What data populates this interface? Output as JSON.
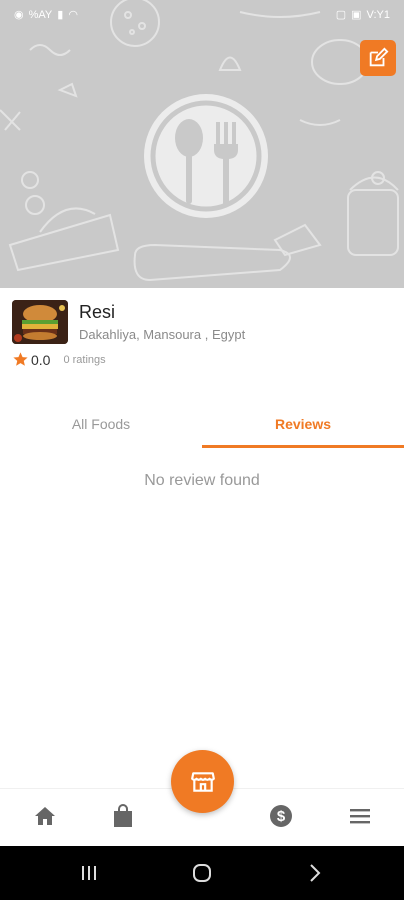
{
  "status_bar": {
    "left_text": "%AY",
    "time": "V:Y1"
  },
  "colors": {
    "accent": "#f07a24",
    "cover_bg": "#c9c9c9"
  },
  "restaurant": {
    "name": "Resi",
    "address": "Dakahliya, Mansoura , Egypt",
    "rating": "0.0",
    "ratings_count": "0 ratings"
  },
  "tabs": [
    {
      "label": "All Foods",
      "active": false
    },
    {
      "label": "Reviews",
      "active": true
    }
  ],
  "reviews": {
    "empty_message": "No review found"
  },
  "bottom_nav": {
    "items": [
      "home-icon",
      "shopping-bag-icon",
      "store-icon",
      "dollar-icon",
      "menu-icon"
    ]
  }
}
